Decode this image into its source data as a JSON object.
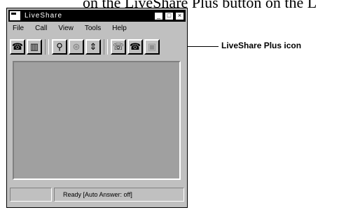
{
  "top_caption": "on the LiveShare Plus button on the L",
  "window": {
    "title": "LiveShare",
    "controls": [
      "_",
      "□",
      "×"
    ]
  },
  "menu": [
    "File",
    "Call",
    "View",
    "Tools",
    "Help"
  ],
  "toolbar": {
    "buttons": [
      {
        "icon": "telephone-icon",
        "glyph": "☎"
      },
      {
        "icon": "book-icon",
        "glyph": "▥"
      },
      {
        "icon": "plug-icon",
        "glyph": "⚲"
      },
      {
        "icon": "speaker-icon",
        "glyph": "⊛"
      },
      {
        "icon": "volume-arrows-icon",
        "glyph": "⇕"
      },
      {
        "icon": "conference-icon",
        "glyph": "☏"
      },
      {
        "icon": "telephone2-icon",
        "glyph": "☎"
      },
      {
        "icon": "liveshare-plus-icon",
        "glyph": "▣"
      }
    ]
  },
  "status": {
    "left": "",
    "text": "Ready [Auto Answer: off]"
  },
  "callout": {
    "label": "LiveShare Plus icon"
  }
}
